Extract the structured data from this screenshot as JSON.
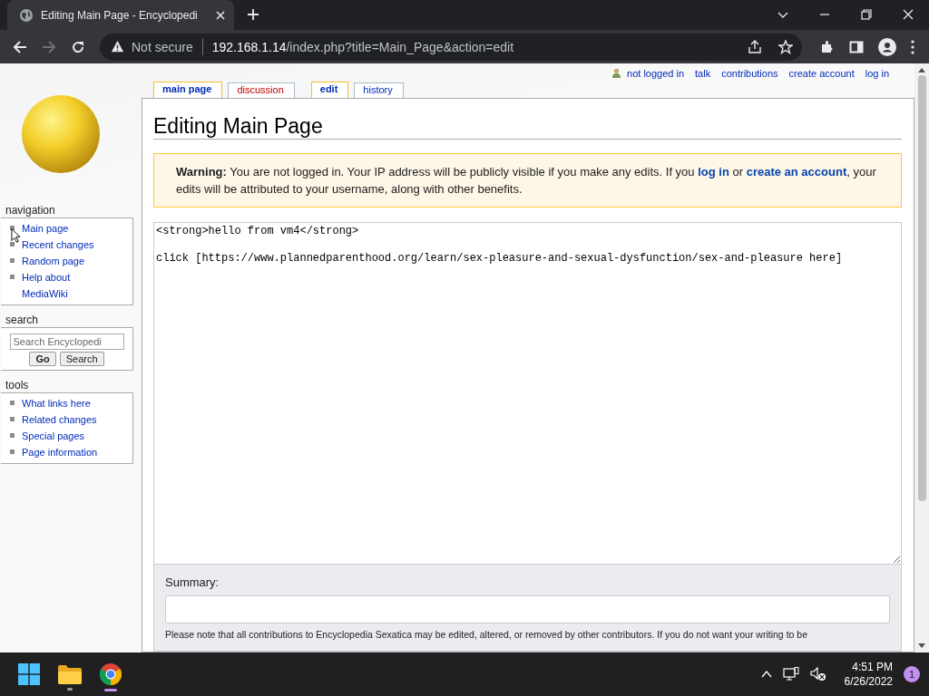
{
  "browser": {
    "tab_title": "Editing Main Page - Encyclopedi",
    "security": "Not secure",
    "host": "192.168.1.14",
    "path": "/index.php?title=Main_Page&action=edit"
  },
  "personal_tools": [
    "not logged in",
    "talk",
    "contributions",
    "create account",
    "log in"
  ],
  "tabs": [
    {
      "label": "main page",
      "selected": true,
      "kind": "page"
    },
    {
      "label": "discussion",
      "selected": false,
      "kind": "redlink"
    },
    {
      "label": "edit",
      "selected": true,
      "kind": "page"
    },
    {
      "label": "history",
      "selected": false,
      "kind": "page"
    }
  ],
  "sidebar": {
    "navigation": {
      "title": "navigation",
      "items": [
        "Main page",
        "Recent changes",
        "Random page",
        "Help about MediaWiki"
      ]
    },
    "search": {
      "title": "search",
      "placeholder": "Search Encyclopedi",
      "buttons": [
        "Go",
        "Search"
      ]
    },
    "tools": {
      "title": "tools",
      "items": [
        "What links here",
        "Related changes",
        "Special pages",
        "Page information"
      ]
    }
  },
  "heading": "Editing Main Page",
  "warning": [
    {
      "kind": "text",
      "text": "**Warning:** You are not logged in. Your IP address will be publicly visible if you make any edits. If you "
    },
    {
      "kind": "link",
      "text": "log in"
    },
    {
      "kind": "text",
      "text": " or "
    },
    {
      "kind": "link",
      "text": "create an account"
    },
    {
      "kind": "text",
      "text": ", your edits will be attributed to your username, along with other benefits."
    }
  ],
  "editor": {
    "value": "<strong>hello from vm4</strong>\n\nclick [https://www.plannedparenthood.org/learn/sex-pleasure-and-sexual-dysfunction/sex-and-pleasure here]"
  },
  "summary": {
    "label": "Summary:"
  },
  "note": "Please note that all contributions to Encyclopedia Sexatica may be edited, altered, or removed by other contributors. If you do not want your writing to be",
  "taskbar": {
    "time": "4:51 PM",
    "date": "6/26/2022",
    "notifications": "1"
  }
}
